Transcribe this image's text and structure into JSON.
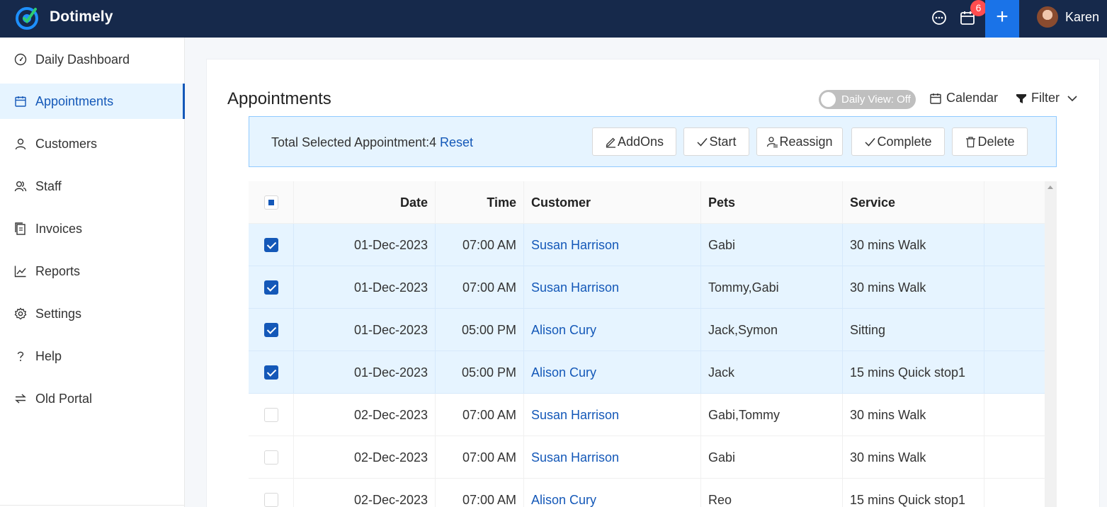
{
  "app": {
    "brand": "Dotimely"
  },
  "topbar": {
    "notification_count": "6",
    "add_label": "+",
    "user_name": "Karen"
  },
  "sidebar": {
    "items": [
      {
        "label": "Daily Dashboard"
      },
      {
        "label": "Appointments"
      },
      {
        "label": "Customers"
      },
      {
        "label": "Staff"
      },
      {
        "label": "Invoices"
      },
      {
        "label": "Reports"
      },
      {
        "label": "Settings"
      },
      {
        "label": "Help"
      },
      {
        "label": "Old Portal"
      }
    ],
    "active_index": 1
  },
  "page": {
    "title": "Appointments",
    "daily_view_label": "Daily View: Off",
    "calendar_label": "Calendar",
    "filter_label": "Filter"
  },
  "selection": {
    "summary": "Total Selected Appointment:4",
    "reset_label": "Reset",
    "actions": {
      "addons": "AddOns",
      "start": "Start",
      "reassign": "Reassign",
      "complete": "Complete",
      "delete": "Delete"
    }
  },
  "table": {
    "headers": {
      "date": "Date",
      "time": "Time",
      "customer": "Customer",
      "pets": "Pets",
      "service": "Service"
    },
    "rows": [
      {
        "checked": true,
        "date": "01-Dec-2023",
        "time": "07:00 AM",
        "customer": "Susan Harrison",
        "pets": "Gabi",
        "service": "30 mins Walk"
      },
      {
        "checked": true,
        "date": "01-Dec-2023",
        "time": "07:00 AM",
        "customer": "Susan Harrison",
        "pets": "Tommy,Gabi",
        "service": "30 mins Walk"
      },
      {
        "checked": true,
        "date": "01-Dec-2023",
        "time": "05:00 PM",
        "customer": "Alison Cury",
        "pets": "Jack,Symon",
        "service": "Sitting"
      },
      {
        "checked": true,
        "date": "01-Dec-2023",
        "time": "05:00 PM",
        "customer": "Alison Cury",
        "pets": "Jack",
        "service": "15 mins Quick stop1"
      },
      {
        "checked": false,
        "date": "02-Dec-2023",
        "time": "07:00 AM",
        "customer": "Susan Harrison",
        "pets": "Gabi,Tommy",
        "service": "30 mins Walk"
      },
      {
        "checked": false,
        "date": "02-Dec-2023",
        "time": "07:00 AM",
        "customer": "Susan Harrison",
        "pets": "Gabi",
        "service": "30 mins Walk"
      },
      {
        "checked": false,
        "date": "02-Dec-2023",
        "time": "07:00 AM",
        "customer": "Alison Cury",
        "pets": "Reo",
        "service": "15 mins Quick stop1"
      }
    ]
  },
  "colors": {
    "topbar": "#16294b",
    "accent": "#1458b8",
    "add_button": "#1a73e8",
    "selected_row": "#e6f4ff",
    "badge": "#ff4d4f"
  }
}
